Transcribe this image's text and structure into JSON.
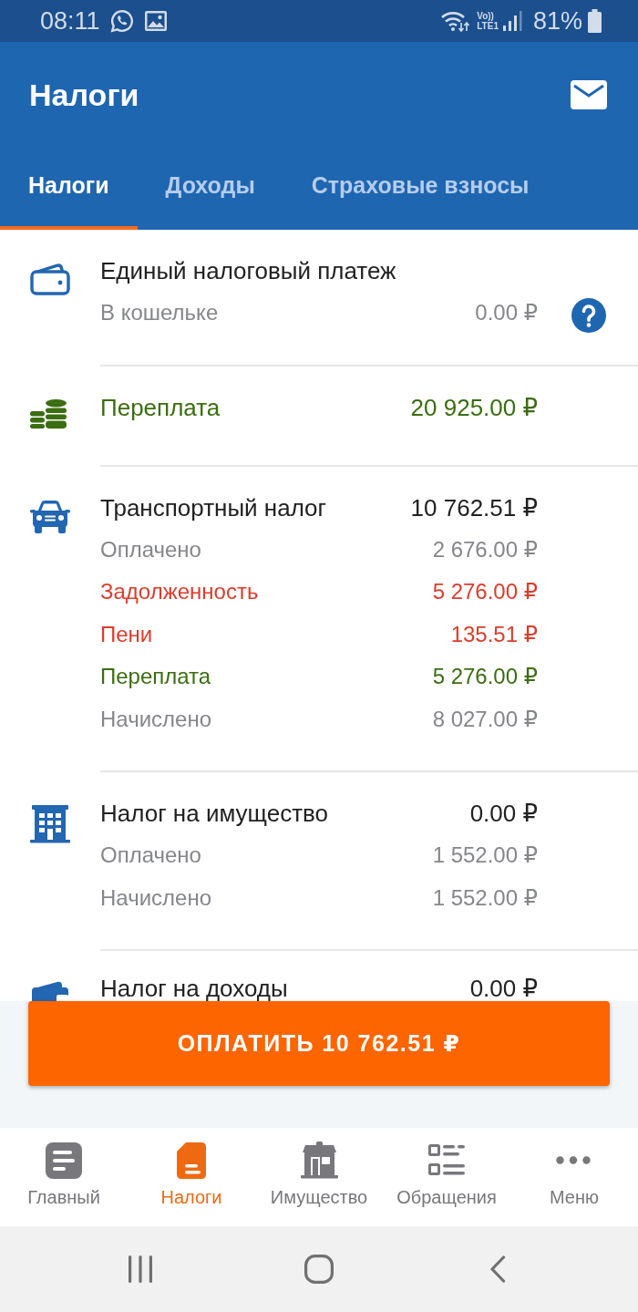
{
  "status_bar": {
    "time": "08:11",
    "volte": "Vo))",
    "network": "LTE1",
    "battery": "81%"
  },
  "app_bar": {
    "title": "Налоги"
  },
  "tabs": [
    {
      "label": "Налоги",
      "selected": true
    },
    {
      "label": "Доходы",
      "selected": false
    },
    {
      "label": "Страховые взносы",
      "selected": false
    }
  ],
  "sections": [
    {
      "kind": "wallet",
      "title": "Единый налоговый платеж",
      "color": "#212121",
      "help": true,
      "rows": [
        {
          "label": "В кошельке",
          "amount": "0.00 ₽",
          "color": "#85868b"
        }
      ]
    },
    {
      "kind": "coins",
      "title": "Переплата",
      "amount": "20 925.00 ₽",
      "color": "#3b6d11"
    },
    {
      "kind": "car",
      "title": "Транспортный налог",
      "amount": "10 762.51 ₽",
      "color": "#212121",
      "rows": [
        {
          "label": "Оплачено",
          "amount": "2 676.00 ₽",
          "color": "#85868b"
        },
        {
          "label": "Задолженность",
          "amount": "5 276.00 ₽",
          "color": "#dc3c2c"
        },
        {
          "label": "Пени",
          "amount": "135.51 ₽",
          "color": "#dc3c2c"
        },
        {
          "label": "Переплата",
          "amount": "5 276.00 ₽",
          "color": "#3b6d11"
        },
        {
          "label": "Начислено",
          "amount": "8 027.00 ₽",
          "color": "#85868b"
        }
      ]
    },
    {
      "kind": "building",
      "title": "Налог на имущество",
      "amount": "0.00 ₽",
      "color": "#212121",
      "rows": [
        {
          "label": "Оплачено",
          "amount": "1 552.00 ₽",
          "color": "#85868b"
        },
        {
          "label": "Начислено",
          "amount": "1 552.00 ₽",
          "color": "#85868b"
        }
      ]
    },
    {
      "kind": "card",
      "title": "Налог на доходы",
      "amount": "0.00 ₽",
      "color": "#212121"
    }
  ],
  "pay_button": {
    "label": "ОПЛАТИТЬ 10 762.51 ₽"
  },
  "bottom_nav": [
    {
      "kind": "home",
      "label": "Главный",
      "selected": false
    },
    {
      "kind": "taxes",
      "label": "Налоги",
      "selected": true
    },
    {
      "kind": "property",
      "label": "Имущество",
      "selected": false
    },
    {
      "kind": "requests",
      "label": "Обращения",
      "selected": false
    },
    {
      "kind": "menu",
      "label": "Меню",
      "selected": false
    }
  ]
}
